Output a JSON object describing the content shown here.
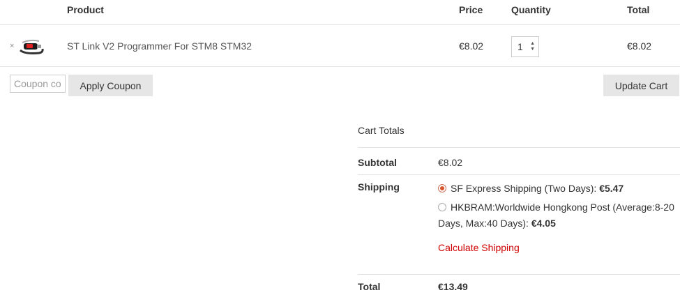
{
  "table_header": {
    "product": "Product",
    "price": "Price",
    "quantity": "Quantity",
    "total": "Total"
  },
  "cart_item": {
    "remove": "×",
    "name": "ST Link V2 Programmer For STM8 STM32",
    "price": "€8.02",
    "quantity": "1",
    "total": "€8.02"
  },
  "coupon": {
    "placeholder": "Coupon code",
    "apply_label": "Apply Coupon"
  },
  "update_label": "Update Cart",
  "cart_totals": {
    "title": "Cart Totals",
    "subtotal_label": "Subtotal",
    "subtotal_value": "€8.02",
    "shipping_label": "Shipping",
    "shipping_options": [
      {
        "label": "SF Express Shipping (Two Days): ",
        "price": "€5.47",
        "selected": true
      },
      {
        "label": "HKBRAM:Worldwide Hongkong Post (Average:8-20 Days, Max:40 Days): ",
        "price": "€4.05",
        "selected": false
      }
    ],
    "calculate_label": "Calculate Shipping",
    "total_label": "Total",
    "total_value": "€13.49"
  },
  "colors": {
    "accent_red": "#d00000",
    "radio_selected": "#d9532c",
    "button_bg": "#e6e6e6"
  }
}
